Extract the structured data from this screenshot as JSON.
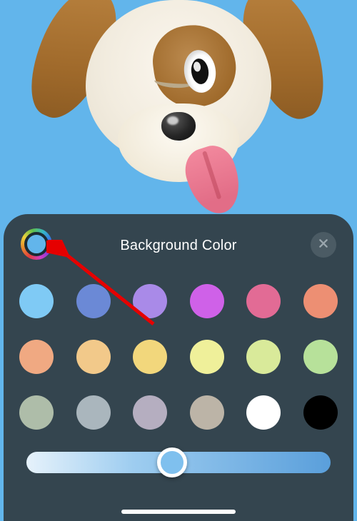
{
  "preview": {
    "background_color": "#62b5eb",
    "memoji": "dog-winking"
  },
  "sheet": {
    "title": "Background Color",
    "color_wheel_selected": "#62b5eb",
    "close_icon": "close-icon",
    "swatches": [
      "#7fcaf5",
      "#6b89d6",
      "#a98ae8",
      "#cf61e8",
      "#e26b95",
      "#ed8f73",
      "#f0a982",
      "#f2c98a",
      "#f2d77c",
      "#eff09a",
      "#d9ea9a",
      "#b7e19a",
      "#aebda9",
      "#aab6bd",
      "#b5aec0",
      "#bcb4a7",
      "#ffffff",
      "#000000"
    ],
    "slider": {
      "position_pct": 48
    }
  },
  "annotation": {
    "arrow_points_to": "color-wheel-button"
  }
}
